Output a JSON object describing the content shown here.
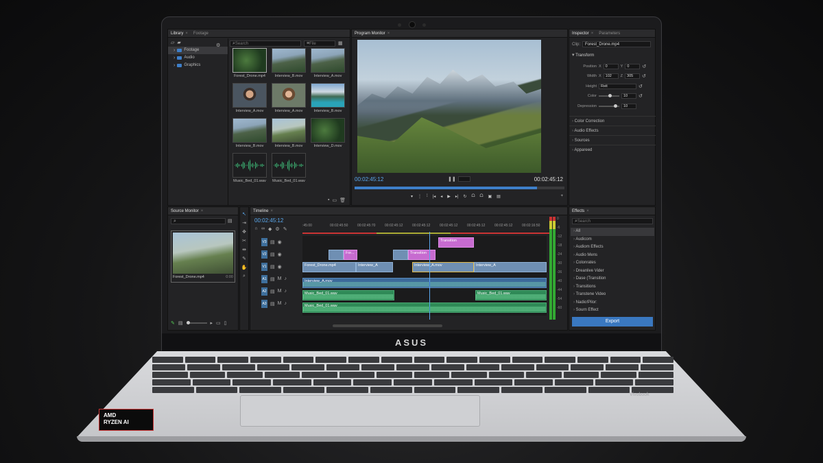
{
  "brand": "ASUS",
  "sticker": {
    "line1": "AMD",
    "line2": "RYZEN AI"
  },
  "deck_mark": "Vivobook",
  "library": {
    "tabs": [
      "Library",
      "Footage"
    ],
    "search_placeholder": "Search",
    "filter_label": "File",
    "folders": [
      "Footage",
      "Audio",
      "Graphics"
    ],
    "thumbs": [
      {
        "label": "Forest_Drone.mp4",
        "kind": "forest"
      },
      {
        "label": "Interview_B.mov",
        "kind": "mtn"
      },
      {
        "label": "Interview_A.mov",
        "kind": "mtn"
      },
      {
        "label": "Interview_A.mov",
        "kind": "face"
      },
      {
        "label": "Interview_A.mov",
        "kind": "face2"
      },
      {
        "label": "Interview_B.mov",
        "kind": "lake"
      },
      {
        "label": "Interview_B.mov",
        "kind": "mtn"
      },
      {
        "label": "Interview_B.mov",
        "kind": "hiker"
      },
      {
        "label": "Interview_D.mov",
        "kind": "forest"
      },
      {
        "label": "Music_Bed_01.wav",
        "kind": "wave"
      },
      {
        "label": "Music_Bed_01.wav",
        "kind": "wave"
      }
    ]
  },
  "program_monitor": {
    "tab": "Program Monitor",
    "timecode_left": "00:02:45:12",
    "timecode_right": "00:02:45:12",
    "playhead_fraction": 0.87
  },
  "inspector": {
    "tabs": [
      "Inspector",
      "Parameters"
    ],
    "clip_label": "Clip:",
    "clip_value": "Forest_Drone.mp4",
    "transform_label": "Transform",
    "position_label": "Position",
    "pos_x": "0",
    "pos_y": "0",
    "width_label": "Width",
    "width_x": "102",
    "width_z": "305",
    "height_label": "Height",
    "height_value": "Reit",
    "color_label": "Color",
    "color_value": "10",
    "depression_label": "Depression",
    "depression_value": "10",
    "sections": [
      "Color Correction",
      "Audio Effects",
      "Sources",
      "Appareed"
    ]
  },
  "source_monitor": {
    "tab": "Source Monitor",
    "clip_label": "Forest_Drone.mp4",
    "clip_duration": "0:00"
  },
  "timeline": {
    "tab": "Timeline",
    "timecode": "00:02:45:12",
    "ruler": [
      ":45:00",
      "00:02:45:50",
      "00:02:45:70",
      "00:02:45:12",
      "00:02:45:12",
      "00:02:45:12",
      "00:02:45:12",
      "00:02:45:12",
      "00:02:16:50"
    ],
    "tracks": [
      "V3",
      "V2",
      "V1",
      "A1",
      "A2",
      "A3"
    ],
    "video_clips": [
      {
        "label": "Transition"
      },
      {
        "label": "For..."
      },
      {
        "label": "Transition"
      },
      {
        "label": "Forest_Drone.mp4"
      },
      {
        "label": "Interview_A"
      },
      {
        "label": "Interview_A.mov"
      },
      {
        "label": "Interview_A"
      }
    ],
    "audio_clips": [
      {
        "label": "Interview_A.mov"
      },
      {
        "label": "Music_Bed_01.wav"
      },
      {
        "label": "Music_Bed_01.wav"
      },
      {
        "label": "Music_Bed_01.wav"
      }
    ],
    "meter_labels": [
      "0",
      "-6",
      "-12",
      "-18",
      "-24",
      "-30",
      "-36",
      "-40",
      "-44",
      "-54",
      "-60"
    ]
  },
  "effects": {
    "tab": "Effects",
    "search_placeholder": "Search",
    "items": [
      "All",
      "Audicom",
      "Audiom Effects",
      "Audio Mens",
      "Colonrates",
      "Dreanlive Vider",
      "Dase (Transition",
      "Transitions",
      "Transtene Video",
      "Nadio!Pilor:",
      "Sourn Effect"
    ],
    "export_label": "Export"
  },
  "colors": {
    "accent": "#3e7fc9",
    "export_button": "#3a78c0",
    "transition_clip": "#c76bd0",
    "audio_clip": "#2f8a57",
    "timecode": "#5aa9ef"
  }
}
